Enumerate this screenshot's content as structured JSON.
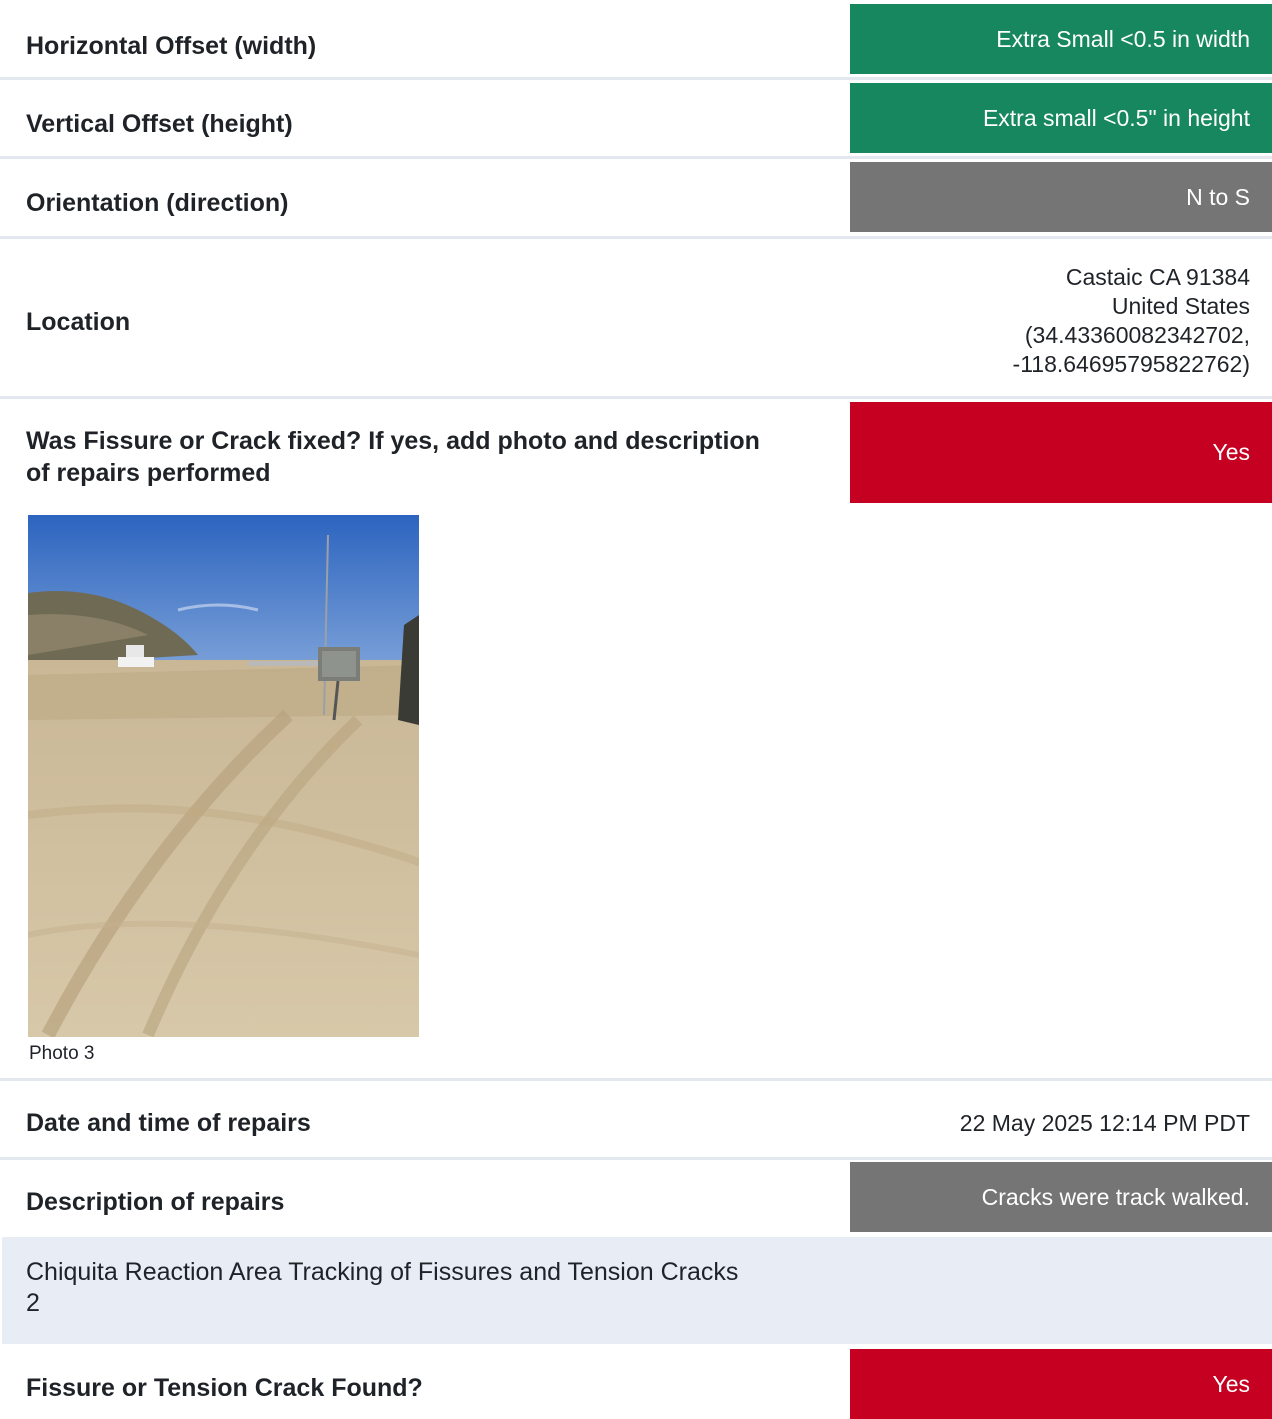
{
  "rows": [
    {
      "label": "Horizontal Offset (width)",
      "value": "Extra Small <0.5 in width",
      "color": "#178760"
    },
    {
      "label": "Vertical Offset (height)",
      "value": "Extra small <0.5\" in height",
      "color": "#178760"
    },
    {
      "label": "Orientation (direction)",
      "value": "N to S",
      "color": "#757575"
    }
  ],
  "location": {
    "label": "Location",
    "lines": [
      "Castaic CA 91384",
      "United States",
      "(34.43360082342702,",
      "-118.64695795822762)"
    ]
  },
  "fixed": {
    "label_line1": "Was Fissure or Crack fixed? If yes, add photo and description",
    "label_line2": "of repairs performed",
    "value": "Yes",
    "color": "#c50021"
  },
  "photo": {
    "caption": "Photo 3"
  },
  "repairs_date": {
    "label": "Date and time of repairs",
    "value": "22 May 2025 12:14 PM PDT"
  },
  "repairs_desc": {
    "label": "Description of repairs",
    "value": "Cracks were track walked.",
    "color": "#757575"
  },
  "section": {
    "title_line1": "Chiquita Reaction Area Tracking of Fissures and Tension Cracks",
    "title_line2": "2"
  },
  "found": {
    "label": "Fissure or Tension Crack Found?",
    "value": "Yes",
    "color": "#c50021"
  }
}
